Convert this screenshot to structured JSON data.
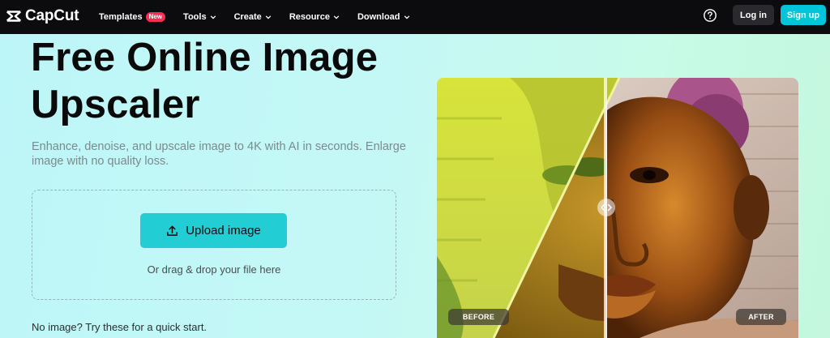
{
  "brand": {
    "name": "CapCut"
  },
  "nav": {
    "items": [
      {
        "label": "Templates",
        "badge": "New"
      },
      {
        "label": "Tools"
      },
      {
        "label": "Create"
      },
      {
        "label": "Resource"
      },
      {
        "label": "Download"
      }
    ],
    "help_icon": "question-circle-icon",
    "login": "Log in",
    "signup": "Sign up"
  },
  "hero": {
    "title": "Free Online Image Upscaler",
    "subtitle": "Enhance, denoise, and upscale image to 4K with AI in seconds. Enlarge image with no quality loss.",
    "upload_button": "Upload image",
    "upload_icon": "upload-icon",
    "drop_hint": "Or drag & drop your file here",
    "quick_start": "No image? Try these for a quick start."
  },
  "compare": {
    "before_label": "BEFORE",
    "after_label": "AFTER",
    "handle_icon": "drag-arrows-icon"
  },
  "colors": {
    "nav_bg": "#0c0c0e",
    "accent": "#00c4d9",
    "upload": "#22cdd4",
    "badge": "#fe2c55"
  }
}
